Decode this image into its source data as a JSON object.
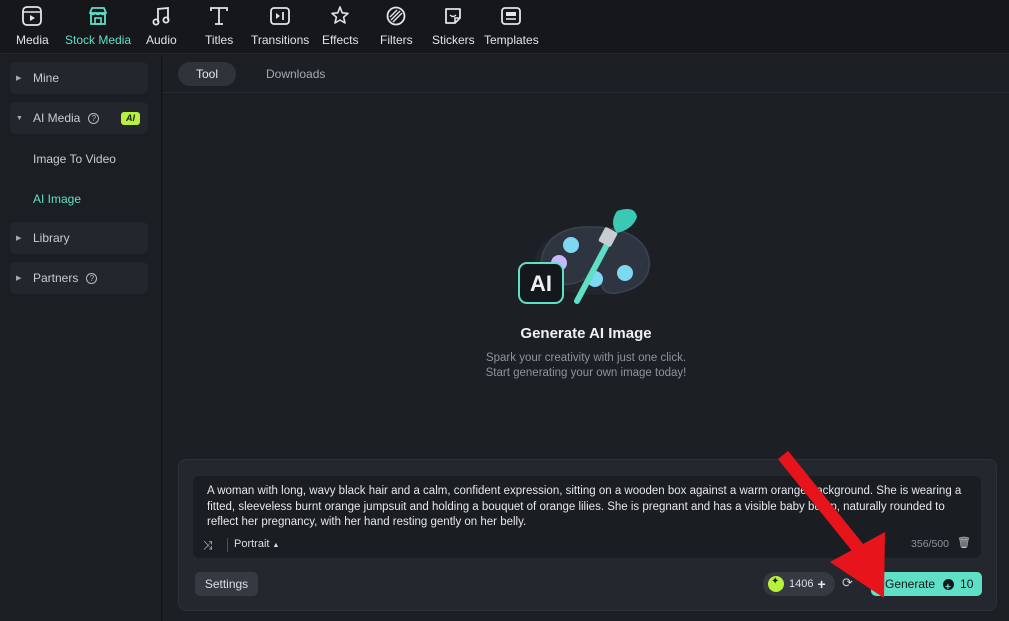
{
  "toolbar": {
    "items": [
      {
        "label": "Media",
        "icon": "media-icon"
      },
      {
        "label": "Stock Media",
        "icon": "stock-media-icon",
        "active": true
      },
      {
        "label": "Audio",
        "icon": "music-note-icon"
      },
      {
        "label": "Titles",
        "icon": "text-icon"
      },
      {
        "label": "Transitions",
        "icon": "transitions-icon"
      },
      {
        "label": "Effects",
        "icon": "effects-icon"
      },
      {
        "label": "Filters",
        "icon": "filters-icon"
      },
      {
        "label": "Stickers",
        "icon": "stickers-icon"
      },
      {
        "label": "Templates",
        "icon": "templates-icon"
      }
    ]
  },
  "sidebar": {
    "mine": "Mine",
    "ai_media": "AI Media",
    "ai_badge": "AI",
    "image_to_video": "Image To Video",
    "ai_image": "AI Image",
    "library": "Library",
    "partners": "Partners"
  },
  "tabs": {
    "tool": "Tool",
    "downloads": "Downloads"
  },
  "hero": {
    "title": "Generate AI Image",
    "subtitle_line1": "Spark your creativity with just one click.",
    "subtitle_line2": "Start generating your own image today!",
    "icon_text": "AI"
  },
  "prompt": {
    "text": "A woman with long, wavy black hair and a calm, confident expression, sitting on a wooden box against a warm orange background. She is wearing a fitted, sleeveless burnt orange jumpsuit and holding a bouquet of orange lilies. She is pregnant and has a visible baby bump, naturally rounded to reflect her pregnancy, with her hand resting gently on her belly.",
    "ratio": "Portrait",
    "counter": "356/500"
  },
  "actions": {
    "settings": "Settings",
    "credits": "1406",
    "generate": "Generate",
    "generate_cost": "10"
  },
  "colors": {
    "accent": "#5fe0c6",
    "ai_badge": "#b8f03e",
    "annotation_arrow": "#e8141c"
  }
}
